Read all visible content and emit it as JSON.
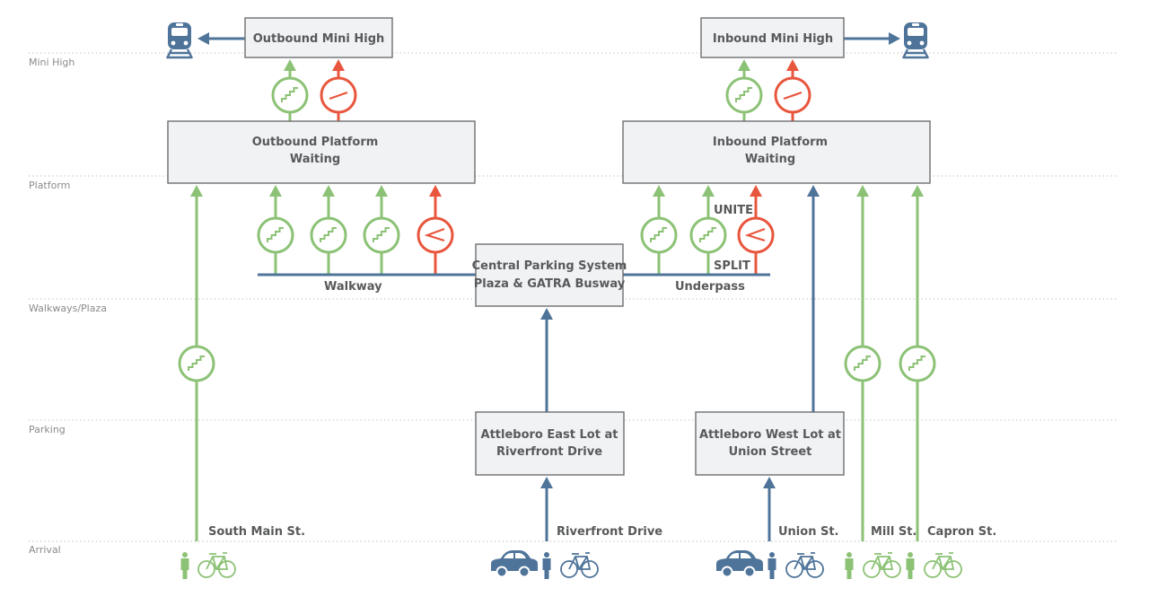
{
  "colors": {
    "green": "#8cc276",
    "red": "#e8563d",
    "blue": "#4f7499",
    "text": "#58595b",
    "level": "#8a8b8e"
  },
  "levels": [
    {
      "id": "mini-high",
      "label": "Mini High"
    },
    {
      "id": "platform",
      "label": "Platform"
    },
    {
      "id": "walkways-plaza",
      "label": "Walkways/Plaza"
    },
    {
      "id": "parking",
      "label": "Parking"
    },
    {
      "id": "arrival",
      "label": "Arrival"
    }
  ],
  "boxes": {
    "outbound_mini_high": {
      "lines": [
        "Outbound Mini High"
      ]
    },
    "inbound_mini_high": {
      "lines": [
        "Inbound Mini High"
      ]
    },
    "outbound_platform": {
      "lines": [
        "Outbound Platform",
        "Waiting"
      ]
    },
    "inbound_platform": {
      "lines": [
        "Inbound Platform",
        "Waiting"
      ]
    },
    "central_parking": {
      "lines": [
        "Central Parking System",
        "Plaza & GATRA Busway"
      ]
    },
    "east_lot": {
      "lines": [
        "Attleboro East Lot at",
        "Riverfront Drive"
      ]
    },
    "west_lot": {
      "lines": [
        "Attleboro West Lot at",
        "Union Street"
      ]
    }
  },
  "labels": {
    "walkway": "Walkway",
    "underpass": "Underpass",
    "unite": "UNITE",
    "split": "SPLIT",
    "south_main": "South Main St.",
    "riverfront": "Riverfront Drive",
    "union": "Union St.",
    "mill": "Mill St.",
    "capron": "Capron St."
  },
  "connectors": [
    {
      "id": "out-mini-stairs",
      "kind": "stairs",
      "mode": "pedestrian"
    },
    {
      "id": "out-mini-ramp",
      "kind": "ramp",
      "mode": "accessible"
    },
    {
      "id": "in-mini-stairs",
      "kind": "stairs",
      "mode": "pedestrian"
    },
    {
      "id": "in-mini-ramp",
      "kind": "ramp",
      "mode": "accessible"
    },
    {
      "id": "walkway-stairs-1",
      "kind": "stairs",
      "mode": "pedestrian"
    },
    {
      "id": "walkway-stairs-2",
      "kind": "stairs",
      "mode": "pedestrian"
    },
    {
      "id": "walkway-stairs-3",
      "kind": "stairs",
      "mode": "pedestrian"
    },
    {
      "id": "walkway-switchback-ramp",
      "kind": "switchback-ramp",
      "mode": "accessible"
    },
    {
      "id": "underpass-stairs-1",
      "kind": "stairs",
      "mode": "pedestrian"
    },
    {
      "id": "underpass-stairs-2",
      "kind": "stairs",
      "mode": "pedestrian"
    },
    {
      "id": "underpass-switchback-ramp",
      "kind": "switchback-ramp",
      "mode": "accessible"
    },
    {
      "id": "south-main-stairs",
      "kind": "stairs",
      "mode": "pedestrian"
    },
    {
      "id": "mill-stairs",
      "kind": "stairs",
      "mode": "pedestrian"
    },
    {
      "id": "capron-stairs",
      "kind": "stairs",
      "mode": "pedestrian"
    }
  ],
  "legend_icons": {
    "train": "train-icon",
    "car": "car-icon",
    "person": "person-icon",
    "bike": "bicycle-icon",
    "stairs": "stairs-icon",
    "ramp": "ramp-icon",
    "switchback": "switchback-ramp-icon"
  }
}
